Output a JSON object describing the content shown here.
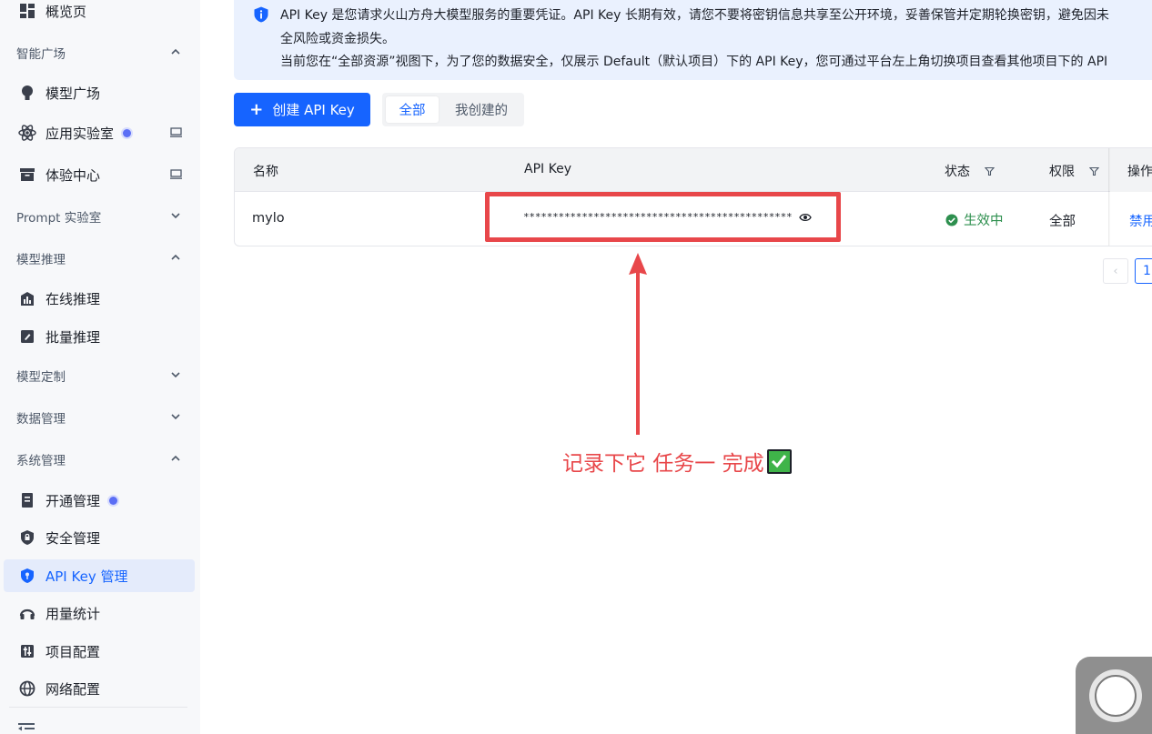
{
  "sidebar": {
    "top_item": "概览页",
    "groups": {
      "smart_plaza": "智能广场",
      "prompt_lab": "Prompt 实验室",
      "model_inference": "模型推理",
      "model_custom": "模型定制",
      "data_mgmt": "数据管理",
      "system_mgmt": "系统管理"
    },
    "items": {
      "model_plaza": "模型广场",
      "app_lab": "应用实验室",
      "experience": "体验中心",
      "online_inference": "在线推理",
      "batch_inference": "批量推理",
      "activation": "开通管理",
      "security": "安全管理",
      "api_key_mgmt": "API Key 管理",
      "usage": "用量统计",
      "project_config": "项目配置",
      "network_config": "网络配置"
    }
  },
  "info": {
    "line1": "API Key 是您请求火山方舟大模型服务的重要凭证。API Key 长期有效，请您不要将密钥信息共享至公开环境，妥善保管并定期轮换密钥，避免因未",
    "line2": "全风险或资金损失。",
    "line3": "当前您在“全部资源”视图下，为了您的数据安全，仅展示 Default（默认项目）下的 API Key，您可通过平台左上角切换项目查看其他项目下的 API"
  },
  "toolbar": {
    "create_label": "创建 API Key",
    "seg_all": "全部",
    "seg_mine": "我创建的"
  },
  "table": {
    "headers": {
      "name": "名称",
      "key": "API Key",
      "status": "状态",
      "perm": "权限",
      "ops": "操作"
    },
    "row": {
      "name": "mylo",
      "key": "**********************************************",
      "status": "生效中",
      "perm": "全部",
      "op": "禁用"
    }
  },
  "pagination": {
    "prev": "‹",
    "current": "1"
  },
  "annotation": {
    "text": "记录下它 任务一 完成"
  },
  "colors": {
    "primary": "#1664ff",
    "annotation": "#e8474a",
    "success": "#2d8f4e"
  }
}
